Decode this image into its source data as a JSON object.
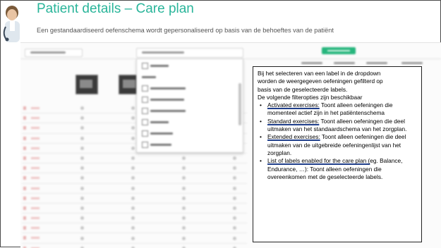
{
  "header": {
    "title": "Patient details – Care plan",
    "subtitle": "Een gestandaardiseerd oefenschema wordt gepersonaliseerd op basis van de behoeftes van de patiënt"
  },
  "colors": {
    "title": "#2ab59a",
    "primary_button": "#27b67d",
    "callout_underline": "#1f3e8a"
  },
  "callout": {
    "intro_lines": [
      "Bij het selecteren van een label in de dropdown",
      "worden de weergegeven oefeningen gefilterd op",
      "basis van de geselecteerde labels.",
      "De volgende filteropties zijn beschikbaar"
    ],
    "options": [
      {
        "key": "Activated exercises:",
        "desc": " Toont alleen oefeningen die momenteel actief zijn in het patiëntenschema"
      },
      {
        "key": "Standard exercises:",
        "desc": " Toont alleen oefeningen die deel uitmaken van het standaardschema van het zorgplan."
      },
      {
        "key": "Extended exercises:",
        "desc": " Toont alleen oefeningen die deel uitmaken van de uitgebreide oefeningenlijst van het zorgplan."
      },
      {
        "key": "List of labels enabled for the care plan (",
        "desc": "eg. Balance, Endurance, …): Toont alleen oefeningen die overeenkomen met de geselecteerde labels."
      }
    ]
  }
}
